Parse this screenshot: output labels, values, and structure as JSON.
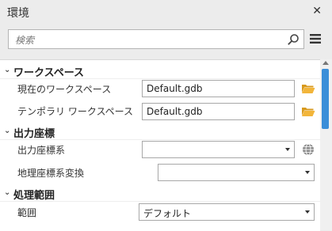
{
  "window": {
    "title": "環境",
    "close_label": "✕"
  },
  "search": {
    "placeholder": "検索"
  },
  "groups": [
    {
      "label": "ワークスペース",
      "items": [
        {
          "label": "現在のワークスペース",
          "value": "Default.gdb"
        },
        {
          "label": "テンポラリ ワークスペース",
          "value": "Default.gdb"
        }
      ]
    },
    {
      "label": "出力座標",
      "items": [
        {
          "label": "出力座標系",
          "value": ""
        },
        {
          "label": "地理座標系変換",
          "value": ""
        }
      ]
    },
    {
      "label": "処理範囲",
      "items": [
        {
          "label": "範囲",
          "value": "デフォルト"
        }
      ]
    }
  ],
  "icons": {
    "close": "close-icon",
    "search": "search-icon",
    "menu": "hamburger-menu-icon",
    "folder": "folder-open-icon",
    "globe": "globe-icon",
    "chevron": "chevron-down-icon"
  },
  "colors": {
    "accent": "#3b8ed8",
    "folder": "#e8a928"
  }
}
